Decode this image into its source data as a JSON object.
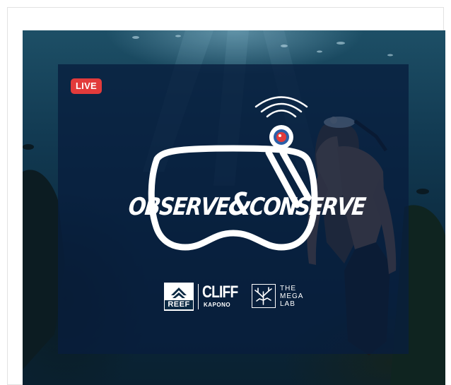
{
  "badge": {
    "live": "LIVE"
  },
  "logo": {
    "title_left": "OBSERVE",
    "title_amp": "&",
    "title_right": "CONSERVE"
  },
  "sponsors": {
    "reef": "REEF",
    "cliff": "CLIFF",
    "cliff_sub": "KAPONO",
    "megalab_line1": "THE",
    "megalab_line2": "MEGA",
    "megalab_line3": "LAB"
  },
  "colors": {
    "live_badge": "#e23b3b",
    "overlay": "#081e3e",
    "water_dark": "#0a2131",
    "water_light": "#1d4f66",
    "logo_white": "#ffffff",
    "camera_red": "#e23b3b"
  },
  "icons": [
    "signal-waves-icon",
    "camera-icon",
    "dive-mask-icon",
    "reef-wave-icon",
    "coral-icon"
  ]
}
